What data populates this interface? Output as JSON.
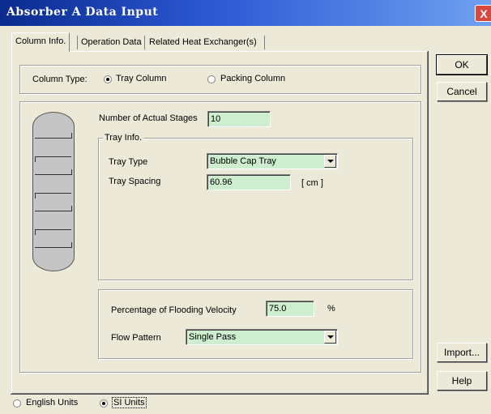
{
  "window": {
    "title": "Absorber A Data Input",
    "close_glyph": "X"
  },
  "tabs": [
    {
      "label": "Column Info."
    },
    {
      "label": "Operation Data"
    },
    {
      "label": "Related Heat Exchanger(s)"
    }
  ],
  "buttons": {
    "ok": "OK",
    "cancel": "Cancel",
    "import": "Import...",
    "help": "Help"
  },
  "column_type": {
    "label": "Column Type:",
    "options": [
      {
        "label": "Tray Column",
        "selected": true
      },
      {
        "label": "Packing Column",
        "selected": false
      }
    ]
  },
  "stages": {
    "label": "Number of Actual Stages",
    "value": "10"
  },
  "tray_info": {
    "group_label": "Tray Info.",
    "type_label": "Tray Type",
    "type_value": "Bubble Cap Tray",
    "spacing_label": "Tray Spacing",
    "spacing_value": "60.96",
    "spacing_unit": "[ cm ]"
  },
  "flooding": {
    "label": "Percentage of Flooding Velocity",
    "value": "75.0",
    "unit": "%"
  },
  "flow_pattern": {
    "label": "Flow Pattern",
    "value": "Single Pass"
  },
  "units": [
    {
      "label": "English Units",
      "selected": false
    },
    {
      "label": "SI Units",
      "selected": true
    }
  ],
  "colors": {
    "field_bg": "#cdeecf",
    "titlebar": "#0a2a8e",
    "face": "#ece9d8"
  }
}
